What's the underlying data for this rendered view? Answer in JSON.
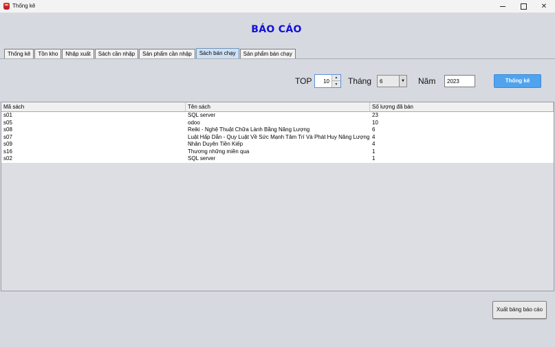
{
  "window": {
    "title": "Thống kê",
    "controls": {
      "minimize": "minimize",
      "maximize": "maximize",
      "close": "close"
    }
  },
  "header": {
    "title": "BÁO CÁO"
  },
  "tabs": [
    {
      "label": "Thống kê"
    },
    {
      "label": "Tồn kho"
    },
    {
      "label": "Nhập xuất"
    },
    {
      "label": "Sách cần nhập"
    },
    {
      "label": "Sản phẩm cần nhập"
    },
    {
      "label": "Sách bán chạy",
      "active": true
    },
    {
      "label": "Sản phẩm bán chạy"
    }
  ],
  "filters": {
    "top_label": "TOP",
    "top_value": "10",
    "month_label": "Tháng",
    "month_value": "6",
    "year_label": "Năm",
    "year_value": "2023",
    "submit_label": "Thống kê"
  },
  "table": {
    "columns": [
      "Mã sách",
      "Tên sách",
      "Số lượng đã bán"
    ],
    "rows": [
      [
        "s01",
        "SQL server",
        "23"
      ],
      [
        "s05",
        "odoo",
        "10"
      ],
      [
        "s08",
        "Reiki - Nghệ Thuật Chữa Lành Bằng Năng Lượng",
        "6"
      ],
      [
        "s07",
        "Luật Hấp Dẫn - Quy Luật Về Sức Mạnh Tâm Trí Và Phát Huy Năng Lượng Tích",
        "4"
      ],
      [
        "s09",
        "Nhân Duyên Tiền Kiếp",
        "4"
      ],
      [
        "s16",
        "Thương những miền qua",
        "1"
      ],
      [
        "s02",
        "SQL server",
        "1"
      ]
    ]
  },
  "footer": {
    "export_label": "Xuất bảng báo cáo"
  },
  "colors": {
    "title": "#1010d8",
    "accent_button": "#4fa3ef",
    "active_tab": "#cfe0f3"
  }
}
